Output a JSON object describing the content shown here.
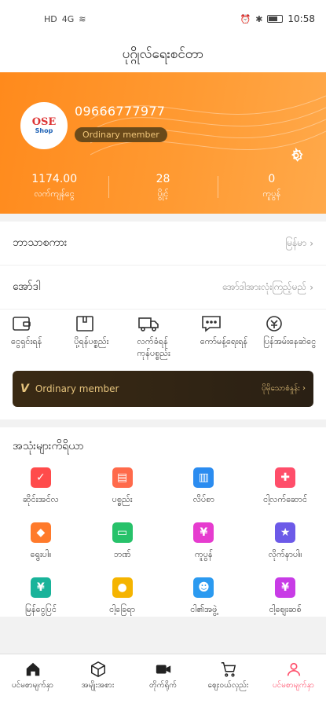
{
  "status_bar": {
    "left_badge": "HD",
    "signal": "4G",
    "time": "10:58"
  },
  "title": "ပုဂ္ဂိုလ်ရေးစင်တာ",
  "profile": {
    "avatar_logo_text": "OSE",
    "avatar_logo_sub": "Shop",
    "phone": "09666777977",
    "member_level": "Ordinary member",
    "stats": [
      {
        "value": "1174.00",
        "label": "လက်ကျန်ငွေ"
      },
      {
        "value": "28",
        "label": "ပွိုင့်"
      },
      {
        "value": "0",
        "label": "ကူပွန်"
      }
    ]
  },
  "settings": [
    {
      "label": "ဘာသာစကား",
      "value": "မြန်မာ"
    },
    {
      "label": "အော်ဒါ",
      "value": "အော်ဒါအားလုံးကြည့်မည်"
    }
  ],
  "quick_actions": [
    {
      "icon": "wallet-icon",
      "label": "ငွေရှင်းရန်"
    },
    {
      "icon": "package-icon",
      "label": "ပို့ရန်ပစ္စည်း"
    },
    {
      "icon": "truck-icon",
      "label": "လက်ခံရန်ကုန်ပစ္စည်း"
    },
    {
      "icon": "comment-icon",
      "label": "ကော်မန့်ရေးရန်"
    },
    {
      "icon": "refund-icon",
      "label": "ပြန်အမ်းနေဆဲငွေ"
    }
  ],
  "vip_bar": {
    "badge": "V",
    "label": "Ordinary member",
    "action": "ပိုမိုသောစံနှုန်း"
  },
  "tools": {
    "title": "အသုံးများကိရိယာ",
    "items": [
      {
        "icon": "calendar-icon",
        "label": "ဆိုင်းအင်လ",
        "color": "#ff4b4b"
      },
      {
        "icon": "card-icon",
        "label": "ပစ္စည်း",
        "color": "#ff6a4b"
      },
      {
        "icon": "building-icon",
        "label": "လိပ်စာ",
        "color": "#2b8cf0"
      },
      {
        "icon": "gift-icon",
        "label": "ငါ့လက်ဆောင်",
        "color": "#ff4e6a"
      },
      {
        "icon": "diamond-icon",
        "label": "ရွေးပါ။",
        "color": "#ff7a2b"
      },
      {
        "icon": "bank-card-icon",
        "label": "ဘဏ်",
        "color": "#27c26a"
      },
      {
        "icon": "coupon-icon",
        "label": "ကူပွန်",
        "color": "#e63ccf"
      },
      {
        "icon": "star-icon",
        "label": "လိုက်နာပါ။",
        "color": "#6c5ae8"
      },
      {
        "icon": "wallet-icon",
        "label": "မြန်ငွေပြင်",
        "color": "#19b39a"
      },
      {
        "icon": "location-icon",
        "label": "ငါ့ခြေရာ",
        "color": "#f5b400"
      },
      {
        "icon": "team-icon",
        "label": "ငါ၏အဖွဲ့",
        "color": "#2b9af0"
      },
      {
        "icon": "discount-icon",
        "label": "ငါ့ဈေးဆစ်",
        "color": "#c83ce6"
      }
    ]
  },
  "bottom_nav": [
    {
      "icon": "home-icon",
      "label": "ပင်မစာမျက်နှာ"
    },
    {
      "icon": "box-icon",
      "label": "အမျိုးအစား"
    },
    {
      "icon": "video-icon",
      "label": "တိုက်ရိုက်"
    },
    {
      "icon": "cart-icon",
      "label": "ဈေးဝယ်လှည်း"
    },
    {
      "icon": "user-icon",
      "label": "ပင်မစာမျက်နှာ",
      "active": true
    }
  ],
  "colors": {
    "accent": "#ff8a1c",
    "active_nav": "#ff4e6a",
    "vip_bg": "#2f2414",
    "vip_text": "#e6c47d"
  }
}
